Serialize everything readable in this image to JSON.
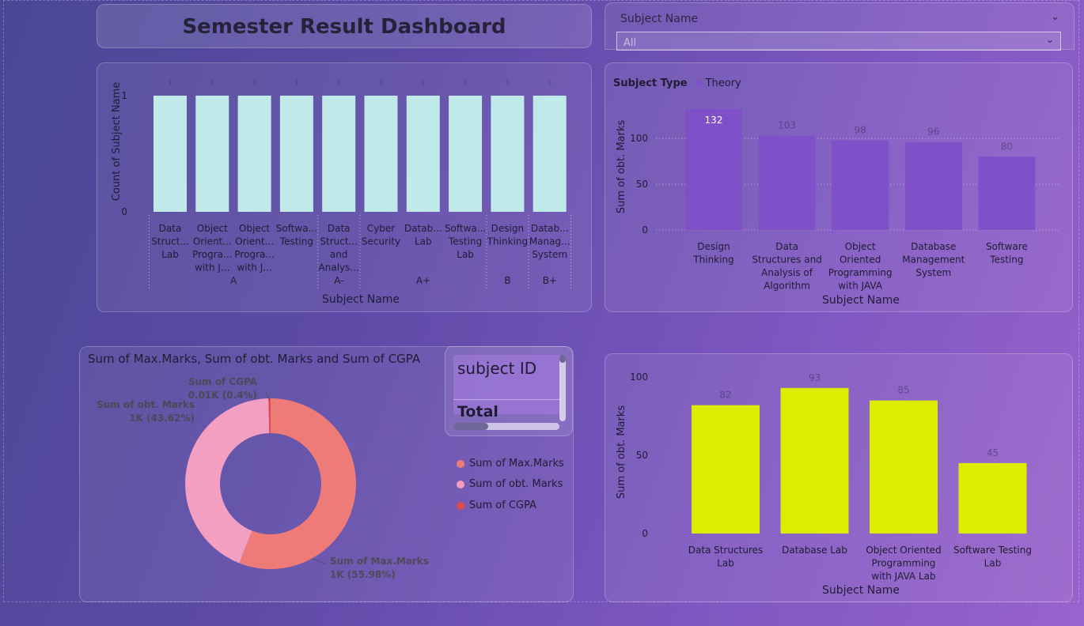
{
  "dashboard": {
    "title": "Semester Result Dashboard"
  },
  "slicer": {
    "label": "Subject Name",
    "value": "All"
  },
  "colors": {
    "teal": "#c0eae9",
    "purple": "#8050c8",
    "yellow": "#dded00",
    "max": "#ee7b78",
    "obt": "#f29fc2",
    "cgpa": "#e04b50"
  },
  "chart1_data": {
    "type": "bar",
    "ylabel": "Count of Subject Name",
    "xlabel": "Subject Name",
    "yticks": [
      0,
      1
    ],
    "ylim": [
      0,
      1
    ],
    "bars": [
      {
        "label": [
          "Data",
          "Struct...",
          "Lab"
        ],
        "value": 1,
        "group": "A"
      },
      {
        "label": [
          "Object",
          "Orient...",
          "Progra...",
          "with J..."
        ],
        "value": 1,
        "group": "A"
      },
      {
        "label": [
          "Object",
          "Orient...",
          "Progra...",
          "with J..."
        ],
        "value": 1,
        "group": "A"
      },
      {
        "label": [
          "Softwa...",
          "Testing"
        ],
        "value": 1,
        "group": "A"
      },
      {
        "label": [
          "Data",
          "Struct...",
          "and",
          "Analys..."
        ],
        "value": 1,
        "group": "A-"
      },
      {
        "label": [
          "Cyber",
          "Security"
        ],
        "value": 1,
        "group": "A+"
      },
      {
        "label": [
          "Datab...",
          "Lab"
        ],
        "value": 1,
        "group": "A+"
      },
      {
        "label": [
          "Softwa...",
          "Testing",
          "Lab"
        ],
        "value": 1,
        "group": "A+"
      },
      {
        "label": [
          "Design",
          "Thinking"
        ],
        "value": 1,
        "group": "B"
      },
      {
        "label": [
          "Datab...",
          "Manag...",
          "System"
        ],
        "value": 1,
        "group": "B+"
      }
    ],
    "groups": [
      "A",
      "A-",
      "A+",
      "B",
      "B+"
    ]
  },
  "chart2_data": {
    "type": "bar",
    "legend_title": "Subject Type",
    "legend_item": "Theory",
    "ylabel": "Sum of obt. Marks",
    "xlabel": "Subject Name",
    "ylim": [
      0,
      132
    ],
    "yticks": [
      0,
      50,
      100
    ],
    "categories": [
      [
        "Design",
        "Thinking"
      ],
      [
        "Data",
        "Structures and",
        "Analysis of",
        "Algorithm"
      ],
      [
        "Object",
        "Oriented",
        "Programming",
        "with JAVA"
      ],
      [
        "Database",
        "Management",
        "System"
      ],
      [
        "Software",
        "Testing"
      ]
    ],
    "values": [
      132,
      103,
      98,
      96,
      80
    ],
    "labels": [
      "132",
      "103",
      "98",
      "96",
      "80"
    ]
  },
  "chart3_data": {
    "type": "pie",
    "title": "Sum of Max.Marks, Sum of obt. Marks and Sum of CGPA",
    "slices": [
      {
        "name": "Sum of Max.Marks",
        "percent": 55.98,
        "label": [
          "Sum of Max.Marks",
          "1K (55.98%)"
        ]
      },
      {
        "name": "Sum of obt. Marks",
        "percent": 43.62,
        "label": [
          "Sum of obt. Marks",
          "1K (43.62%)"
        ]
      },
      {
        "name": "Sum of CGPA",
        "percent": 0.4,
        "label": [
          "Sum of CGPA",
          "0.01K (0.4%)"
        ]
      }
    ]
  },
  "matrix": {
    "header": "subject ID",
    "total": "Total"
  },
  "chart4_data": {
    "type": "bar",
    "ylabel": "Sum of obt. Marks",
    "xlabel": "Subject Name",
    "ylim": [
      0,
      100
    ],
    "yticks": [
      0,
      50,
      100
    ],
    "categories": [
      [
        "Data Structures",
        "Lab"
      ],
      [
        "Database Lab"
      ],
      [
        "Object Oriented",
        "Programming",
        "with JAVA Lab"
      ],
      [
        "Software Testing",
        "Lab"
      ]
    ],
    "values": [
      82,
      93,
      85,
      45
    ],
    "labels": [
      "82",
      "93",
      "85",
      "45"
    ]
  }
}
